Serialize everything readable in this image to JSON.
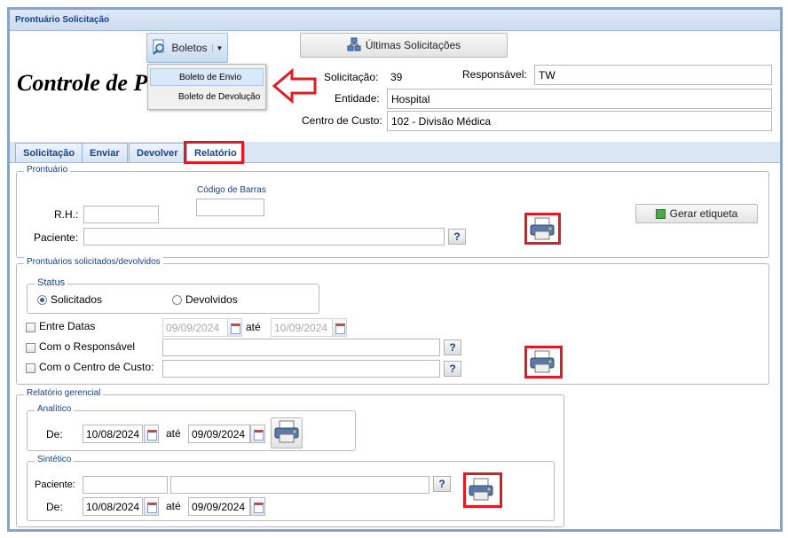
{
  "window": {
    "title": "Prontuário Solicitação"
  },
  "toolbar": {
    "boletos_label": "Boletos",
    "ultimas_label": "Últimas Solicitações",
    "menu": [
      "Boleto de Envio",
      "Boleto de Devolução"
    ]
  },
  "heading": "Controle de P",
  "header": {
    "solicitacao_label": "Solicitação:",
    "solicitacao_value": "39",
    "responsavel_label": "Responsável:",
    "responsavel_value": "TW",
    "entidade_label": "Entidade:",
    "entidade_value": "Hospital",
    "centro_label": "Centro de Custo:",
    "centro_value": "102 - Divisão Médica"
  },
  "tabs": [
    "Solicitação",
    "Enviar",
    "Devolver",
    "Relatório"
  ],
  "prontuario": {
    "legend": "Prontuário",
    "codigo_label": "Código de Barras",
    "rh_label": "R.H.:",
    "paciente_label": "Paciente:",
    "gerar_label": "Gerar etiqueta"
  },
  "solicitados": {
    "legend": "Prontuários solicitados/devolvidos",
    "status_legend": "Status",
    "radio_solicitados": "Solicitados",
    "radio_devolvidos": "Devolvidos",
    "entre_datas": "Entre Datas",
    "date_from": "09/09/2024",
    "ate": "até",
    "date_to": "10/09/2024",
    "com_responsavel": "Com o Responsável",
    "com_centro": "Com o Centro de Custo:"
  },
  "gerencial": {
    "legend": "Relatório gerencial",
    "analitico_legend": "Analítico",
    "de_label": "De:",
    "analitico_from": "10/08/2024",
    "ate": "até",
    "analitico_to": "09/09/2024",
    "sintetico_legend": "Sintético",
    "paciente_label": "Paciente:",
    "sintetico_from": "10/08/2024",
    "sintetico_to": "09/09/2024"
  },
  "help_text": "?",
  "colors": {
    "accent": "#15428b",
    "highlight": "#e01b24",
    "border": "#8aa3c9"
  }
}
